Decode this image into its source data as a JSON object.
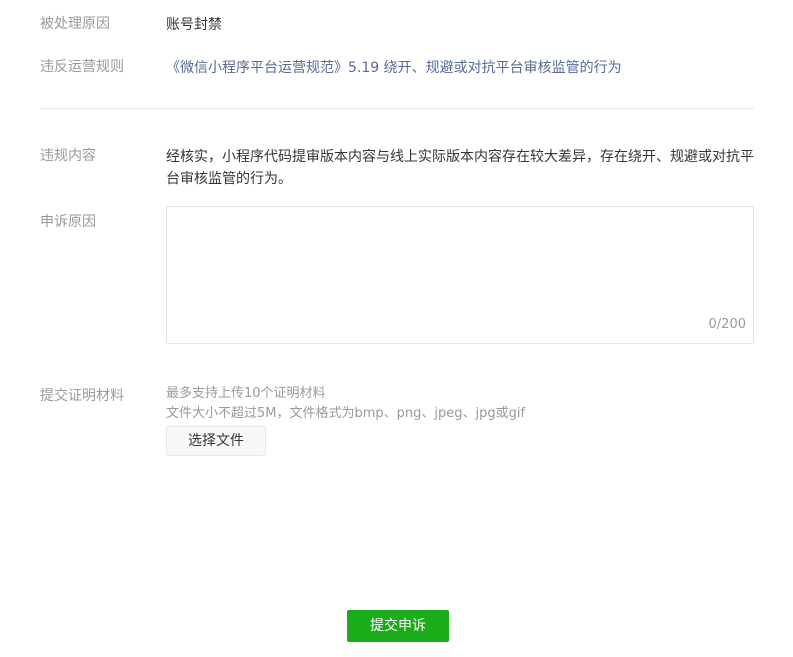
{
  "handle_reason": {
    "label": "被处理原因",
    "value": "账号封禁"
  },
  "violated_rule": {
    "label": "违反运营规则",
    "link_text": "《微信小程序平台运营规范》5.19 绕开、规避或对抗平台审核监管的行为"
  },
  "violation_content": {
    "label": "违规内容",
    "line1": "经核实，小程序代码提审版本内容与线上实际版本内容存在较大差异，存在绕开、规避或对抗平",
    "line2": "台审核监管的行为。"
  },
  "appeal_reason": {
    "label": "申诉原因",
    "value": "",
    "counter": "0/200"
  },
  "evidence": {
    "label": "提交证明材料",
    "hint1": "最多支持上传10个证明材料",
    "hint2": "文件大小不超过5M，文件格式为bmp、png、jpeg、jpg或gif",
    "button_label": "选择文件"
  },
  "submit": {
    "label": "提交申诉",
    "color": "#1aad19"
  },
  "colors": {
    "label": "#9a9a9a",
    "text": "#353535",
    "link": "#576b95",
    "border": "#e7e7eb"
  }
}
